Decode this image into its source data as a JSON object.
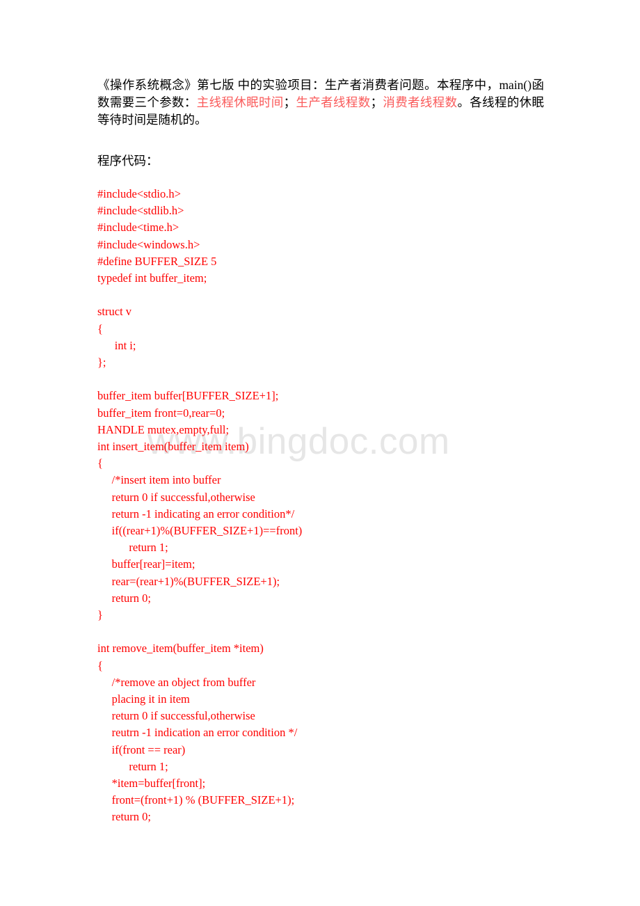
{
  "document": {
    "watermark": "www.bingdoc.com",
    "colors": {
      "code_red": "#ff0000",
      "inline_red": "#fa5a5a",
      "body_text": "#000000",
      "watermark_gray": "#e6e6e6",
      "page_background": "#ffffff"
    },
    "intro": {
      "part1": "《操作系统概念》第七版 中的实验项目：生产者消费者问题。本程序中，main()函数需要三个参数：",
      "param1": "主线程休眠时间",
      "sep1": "；",
      "param2": "生产者线程数",
      "sep2": "；",
      "param3": "消费者线程数",
      "part2": "。各线程的休眠等待时间是随机的。"
    },
    "section_label": "程序代码：",
    "code_lines": [
      "#include<stdio.h>",
      "#include<stdlib.h>",
      "#include<time.h>",
      "#include<windows.h>",
      "#define BUFFER_SIZE 5",
      "typedef int buffer_item;",
      "",
      "struct v",
      "{",
      "      int i;",
      "};",
      "",
      "buffer_item buffer[BUFFER_SIZE+1];",
      "buffer_item front=0,rear=0;",
      "HANDLE mutex,empty,full;",
      "int insert_item(buffer_item item)",
      "{",
      "     /*insert item into buffer",
      "     return 0 if successful,otherwise",
      "     return -1 indicating an error condition*/",
      "     if((rear+1)%(BUFFER_SIZE+1)==front)",
      "           return 1;",
      "     buffer[rear]=item;",
      "     rear=(rear+1)%(BUFFER_SIZE+1);",
      "     return 0;",
      "}",
      "",
      "int remove_item(buffer_item *item)",
      "{",
      "     /*remove an object from buffer",
      "     placing it in item",
      "     return 0 if successful,otherwise",
      "     reutrn -1 indication an error condition */",
      "     if(front == rear)",
      "           return 1;",
      "     *item=buffer[front];",
      "     front=(front+1) % (BUFFER_SIZE+1);",
      "     return 0;"
    ]
  }
}
